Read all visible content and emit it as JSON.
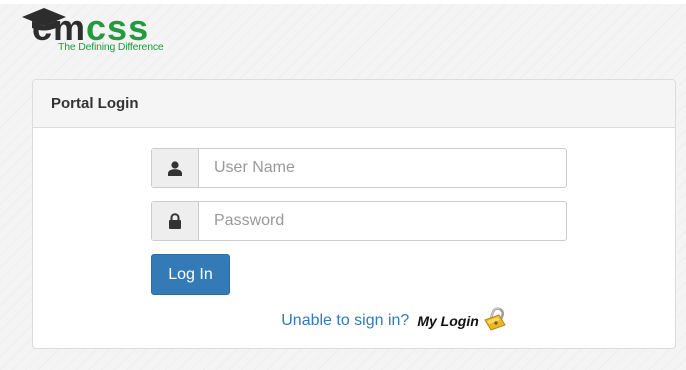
{
  "brand": {
    "name_part1": "cm",
    "name_part2": "css",
    "tagline": "The Defining Difference"
  },
  "panel": {
    "heading": "Portal Login"
  },
  "form": {
    "username_placeholder": "User Name",
    "username_value": "",
    "password_placeholder": "Password",
    "password_value": "",
    "login_label": "Log In"
  },
  "help": {
    "link_text": "Unable to sign in?",
    "mylogin_label": "My Login"
  },
  "colors": {
    "accent": "#337ab7",
    "brand_green": "#239a3e",
    "brand_dark": "#2d2d2d"
  },
  "icons": {
    "username": "user-icon",
    "password": "lock-icon",
    "mylogin": "padlock-icon"
  }
}
